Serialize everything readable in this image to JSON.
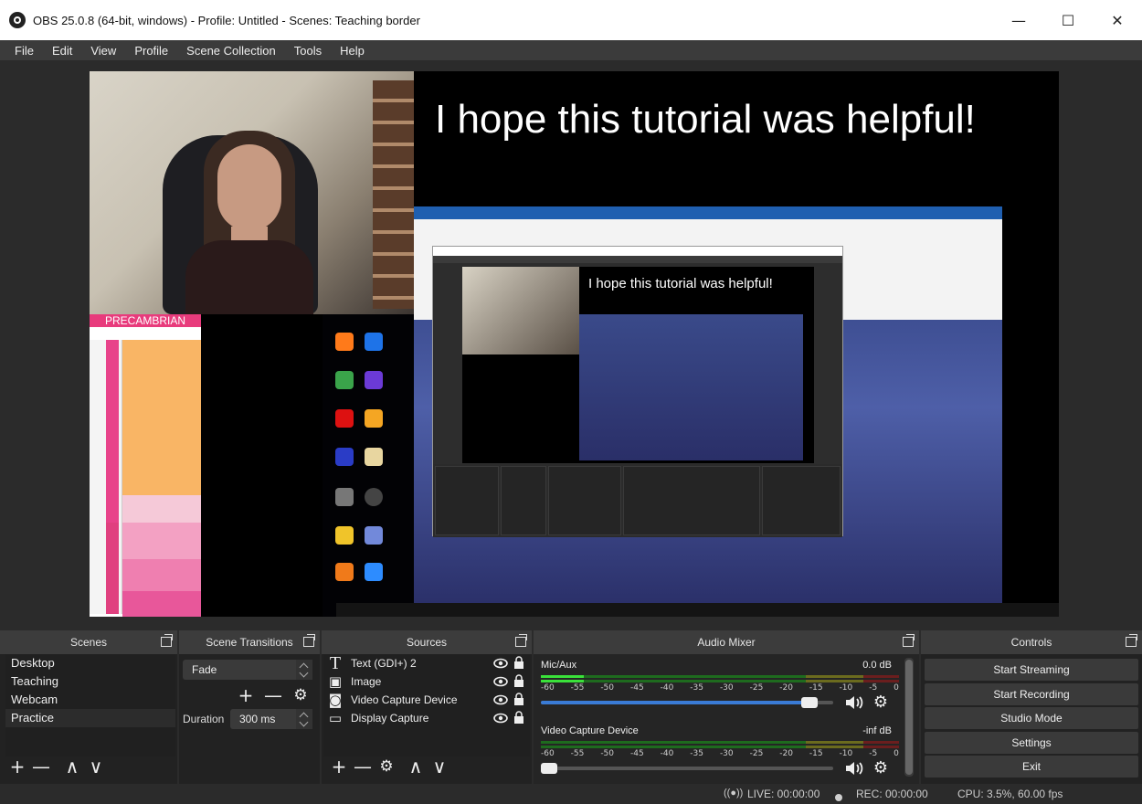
{
  "window": {
    "title": "OBS 25.0.8 (64-bit, windows) - Profile: Untitled - Scenes: Teaching border",
    "minimize": "—",
    "maximize": "☐",
    "close": "✕"
  },
  "menu": [
    "File",
    "Edit",
    "View",
    "Profile",
    "Scene Collection",
    "Tools",
    "Help"
  ],
  "preview": {
    "headline": "I hope this tutorial was helpful!",
    "nested_headline": "I hope this tutorial was helpful!",
    "precambrian_title": "PRECAMBRIAN"
  },
  "scenes": {
    "header": "Scenes",
    "items": [
      "Desktop",
      "Teaching",
      "Webcam",
      "Practice"
    ],
    "selected": "Practice",
    "add": "+",
    "remove": "—",
    "up": "∧",
    "down": "∨"
  },
  "transitions": {
    "header": "Scene Transitions",
    "selected": "Fade",
    "duration_label": "Duration",
    "duration_value": "300 ms",
    "add": "+",
    "remove": "—",
    "gear": "⚙"
  },
  "sources": {
    "header": "Sources",
    "items": [
      {
        "name": "Text (GDI+) 2",
        "icon": "T"
      },
      {
        "name": "Image",
        "icon": "▣"
      },
      {
        "name": "Video Capture Device",
        "icon": "◙"
      },
      {
        "name": "Display Capture",
        "icon": "▭"
      }
    ],
    "add": "+",
    "remove": "—",
    "gear": "⚙",
    "up": "∧",
    "down": "∨"
  },
  "audio_mixer": {
    "header": "Audio Mixer",
    "scale": [
      "-60",
      "-55",
      "-50",
      "-45",
      "-40",
      "-35",
      "-30",
      "-25",
      "-20",
      "-15",
      "-10",
      "-5",
      "0"
    ],
    "tracks": [
      {
        "name": "Mic/Aux",
        "db": "0.0 dB",
        "level": 0.12,
        "volume": 0.92
      },
      {
        "name": "Video Capture Device",
        "db": "-inf dB",
        "level": 0.0,
        "volume": 0.0
      }
    ],
    "volume_icon": "🔊",
    "gear": "⚙"
  },
  "controls": {
    "header": "Controls",
    "buttons": [
      "Start Streaming",
      "Start Recording",
      "Studio Mode",
      "Settings",
      "Exit"
    ]
  },
  "status": {
    "live": "LIVE: 00:00:00",
    "rec": "REC: 00:00:00",
    "cpu": "CPU: 3.5%, 60.00 fps"
  }
}
